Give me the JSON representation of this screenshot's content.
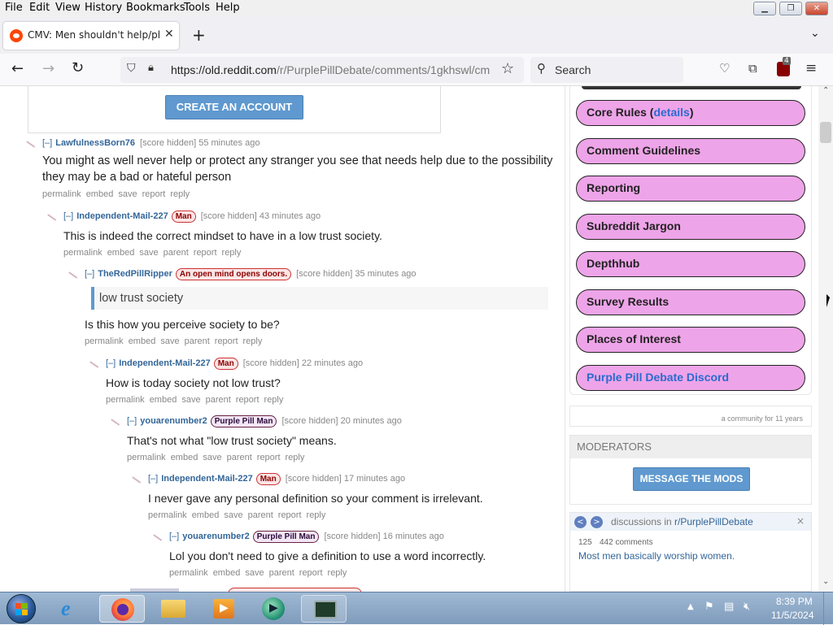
{
  "menubar": {
    "items": [
      "File",
      "Edit",
      "View",
      "History",
      "Bookmarks",
      "Tools",
      "Help"
    ]
  },
  "tab": {
    "title": "CMV: Men shouldn't help/phys"
  },
  "url": {
    "text_host": "https://old.reddit.com",
    "text_path": "/r/PurplePillDebate/comments/1gkhswl/cm"
  },
  "search": {
    "placeholder": "Search"
  },
  "ext_badge": "4",
  "create_account": "CREATE AN ACCOUNT",
  "comments": [
    {
      "toggle": "[–]",
      "author": "LawfulnessBorn76",
      "flair": "",
      "score": "[score hidden]",
      "time": "55 minutes ago",
      "body": "You might as well never help or protect any stranger you see that needs help due to the possibility they may be a bad or hateful person",
      "buttons": [
        "permalink",
        "embed",
        "save",
        "report",
        "reply"
      ]
    },
    {
      "toggle": "[–]",
      "author": "Independent-Mail-227",
      "flair": "Man",
      "score": "[score hidden]",
      "time": "43 minutes ago",
      "body": "This is indeed the correct mindset to have in a low trust society.",
      "buttons": [
        "permalink",
        "embed",
        "save",
        "parent",
        "report",
        "reply"
      ]
    },
    {
      "toggle": "[–]",
      "author": "TheRedPillRipper",
      "flair": "An open mind opens doors.",
      "score": "[score hidden]",
      "time": "35 minutes ago",
      "quote": "low trust society",
      "body": "Is this how you perceive society to be?",
      "buttons": [
        "permalink",
        "embed",
        "save",
        "parent",
        "report",
        "reply"
      ]
    },
    {
      "toggle": "[–]",
      "author": "Independent-Mail-227",
      "flair": "Man",
      "score": "[score hidden]",
      "time": "22 minutes ago",
      "body": "How is today society not low trust?",
      "buttons": [
        "permalink",
        "embed",
        "save",
        "parent",
        "report",
        "reply"
      ]
    },
    {
      "toggle": "[–]",
      "author": "youarenumber2",
      "flair": "Purple Pill Man",
      "score": "[score hidden]",
      "time": "20 minutes ago",
      "body": "That's not what \"low trust society\" means.",
      "buttons": [
        "permalink",
        "embed",
        "save",
        "parent",
        "report",
        "reply"
      ]
    },
    {
      "toggle": "[–]",
      "author": "Independent-Mail-227",
      "flair": "Man",
      "score": "[score hidden]",
      "time": "17 minutes ago",
      "body": "I never gave any personal definition so your comment is irrelevant.",
      "buttons": [
        "permalink",
        "embed",
        "save",
        "parent",
        "report",
        "reply"
      ]
    },
    {
      "toggle": "[–]",
      "author": "youarenumber2",
      "flair": "Purple Pill Man",
      "score": "[score hidden]",
      "time": "16 minutes ago",
      "body": "Lol you don't need to give a definition to use a word incorrectly.",
      "buttons": [
        "permalink",
        "embed",
        "save",
        "parent",
        "report",
        "reply"
      ]
    }
  ],
  "sidebar": {
    "pills": [
      {
        "label": "Core Rules (",
        "link": "details",
        "after": ")"
      },
      {
        "label": "Comment Guidelines"
      },
      {
        "label": "Reporting"
      },
      {
        "label": "Subreddit Jargon"
      },
      {
        "label": "Depthhub"
      },
      {
        "label": "Survey Results"
      },
      {
        "label": "Places of Interest"
      },
      {
        "label": "Purple Pill Debate Discord"
      }
    ],
    "community_age": "a community for 11 years",
    "moderators_title": "MODERATORS",
    "message_mods": "MESSAGE THE MODS",
    "discussions_prefix": "discussions in ",
    "discussions_sub": "r/PurplePillDebate",
    "disc_count": "125",
    "disc_comments": "442 comments",
    "disc_title": "Most men basically worship women."
  },
  "clock": {
    "time": "8:39 PM",
    "date": "11/5/2024"
  },
  "colors": {
    "accent": "#369",
    "pill": "#eea4e8",
    "button": "#5f99cf"
  }
}
